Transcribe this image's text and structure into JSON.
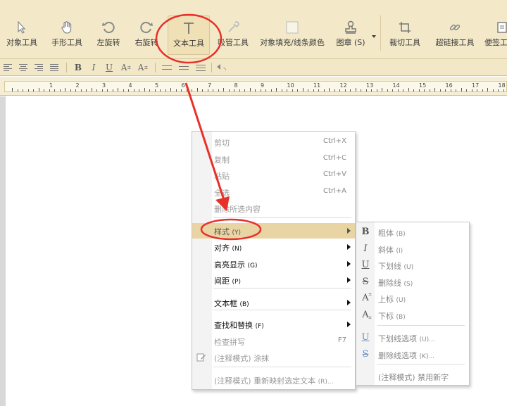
{
  "toolbar": {
    "items": [
      {
        "label": "对象工具",
        "icon": "cursor-arrow"
      },
      {
        "label": "手形工具",
        "icon": "hand"
      },
      {
        "label": "左旋转",
        "icon": "rotate-left"
      },
      {
        "label": "右旋转",
        "icon": "rotate-right"
      },
      {
        "label": "文本工具",
        "icon": "text-T"
      },
      {
        "label": "吸管工具",
        "icon": "eyedropper"
      },
      {
        "label": "对象填充/线条颜色",
        "icon": "fill-square"
      },
      {
        "label": "图章 (S)",
        "icon": "stamp"
      },
      {
        "label": "裁切工具",
        "icon": "crop"
      },
      {
        "label": "超链接工具",
        "icon": "link"
      },
      {
        "label": "便签工",
        "icon": "note"
      }
    ]
  },
  "format_bar": {
    "bold": "B",
    "italic": "I",
    "underline": "U",
    "superscript": "A",
    "superscript_mark": "±",
    "subscript": "A",
    "subscript_mark": "±"
  },
  "ruler": {
    "numbers": [
      "1",
      "2",
      "3",
      "4",
      "5",
      "6",
      "7",
      "8",
      "9",
      "10",
      "11",
      "12",
      "13",
      "14",
      "15",
      "16",
      "17",
      "18"
    ]
  },
  "context_menu": {
    "items": [
      {
        "label": "剪切",
        "shortcut": "Ctrl+X",
        "state": "disabled"
      },
      {
        "label": "复制",
        "shortcut": "Ctrl+C",
        "state": "disabled"
      },
      {
        "label": "粘贴",
        "shortcut": "Ctrl+V",
        "state": "disabled"
      },
      {
        "label": "全选",
        "shortcut": "Ctrl+A",
        "state": "disabled"
      },
      {
        "label": "删除所选内容",
        "shortcut": "",
        "state": "disabled"
      },
      {
        "label": "样式",
        "hotkey": "(Y)",
        "state": "highlighted",
        "submenu": true
      },
      {
        "label": "对齐",
        "hotkey": "(N)",
        "state": "normal",
        "submenu": true
      },
      {
        "label": "高亮显示",
        "hotkey": "(G)",
        "state": "normal",
        "submenu": true
      },
      {
        "label": "间距",
        "hotkey": "(P)",
        "state": "normal",
        "submenu": true
      },
      {
        "label": "文本框",
        "hotkey": "(B)",
        "state": "normal",
        "submenu": true
      },
      {
        "label": "查找和替换",
        "hotkey": "(F)",
        "state": "normal",
        "submenu": true
      },
      {
        "label": "检查拼写",
        "shortcut": "F7",
        "state": "disabled"
      },
      {
        "label": "(注释模式) 涂抹",
        "state": "disabled",
        "icon": "edit-pencil"
      },
      {
        "label": "(注释模式) 重新映射选定文本",
        "hotkey": "(R)...",
        "state": "disabled"
      }
    ]
  },
  "submenu": {
    "items": [
      {
        "icon": "B",
        "label": "粗体",
        "hotkey": "(B)"
      },
      {
        "icon": "I",
        "label": "斜体",
        "hotkey": "(I)"
      },
      {
        "icon": "U",
        "label": "下划线",
        "hotkey": "(U)"
      },
      {
        "icon": "S",
        "label": "删除线",
        "hotkey": "(S)"
      },
      {
        "icon": "A",
        "label": "上标",
        "hotkey": "(U)"
      },
      {
        "icon": "A",
        "label": "下标",
        "hotkey": "(B)"
      },
      {
        "icon": "U",
        "label": "下划线选项",
        "hotkey": "(U)..."
      },
      {
        "icon": "S",
        "label": "删除线选项",
        "hotkey": "(K)..."
      },
      {
        "icon": "",
        "label": "(注释模式) 禁用新字",
        "hotkey": ""
      }
    ]
  },
  "colors": {
    "toolbar_bg": "#f3e9c9",
    "highlight": "#e9d4a4",
    "annotation_red": "#e8302a"
  }
}
